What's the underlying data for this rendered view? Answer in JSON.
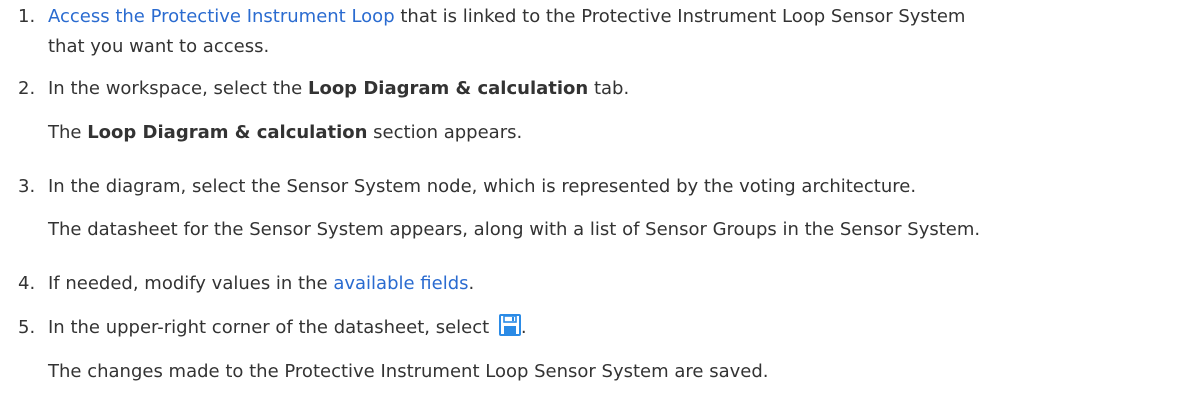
{
  "steps": [
    {
      "number": "1.",
      "link": "Access the Protective Instrument Loop",
      "text_line1": " that is linked to the Protective Instrument Loop Sensor System",
      "text_line2": "that you want to access."
    },
    {
      "number": "2.",
      "pre": "In the workspace, select the ",
      "bold": "Loop Diagram & calculation",
      "post": " tab.",
      "result_bold": "Loop Diagram & calculation",
      "result_post": " section appears.",
      "result_pre": "The "
    },
    {
      "number": "3.",
      "text": "In the diagram, select the Sensor System node, which is represented by the voting architecture.",
      "result": "The datasheet for the Sensor System appears, along with a list of Sensor Groups in the Sensor System."
    },
    {
      "number": "4.",
      "pre": "If needed, modify values in the ",
      "link": "available fields",
      "post": "."
    },
    {
      "number": "5.",
      "pre": "In the upper-right corner of the datasheet, select ",
      "icon": "save-icon",
      "post": ".",
      "result": "The changes made to the Protective Instrument Loop Sensor System are saved."
    }
  ],
  "colors": {
    "text": "#333333",
    "link": "#2a6bd0",
    "icon": "#2b8be6"
  }
}
